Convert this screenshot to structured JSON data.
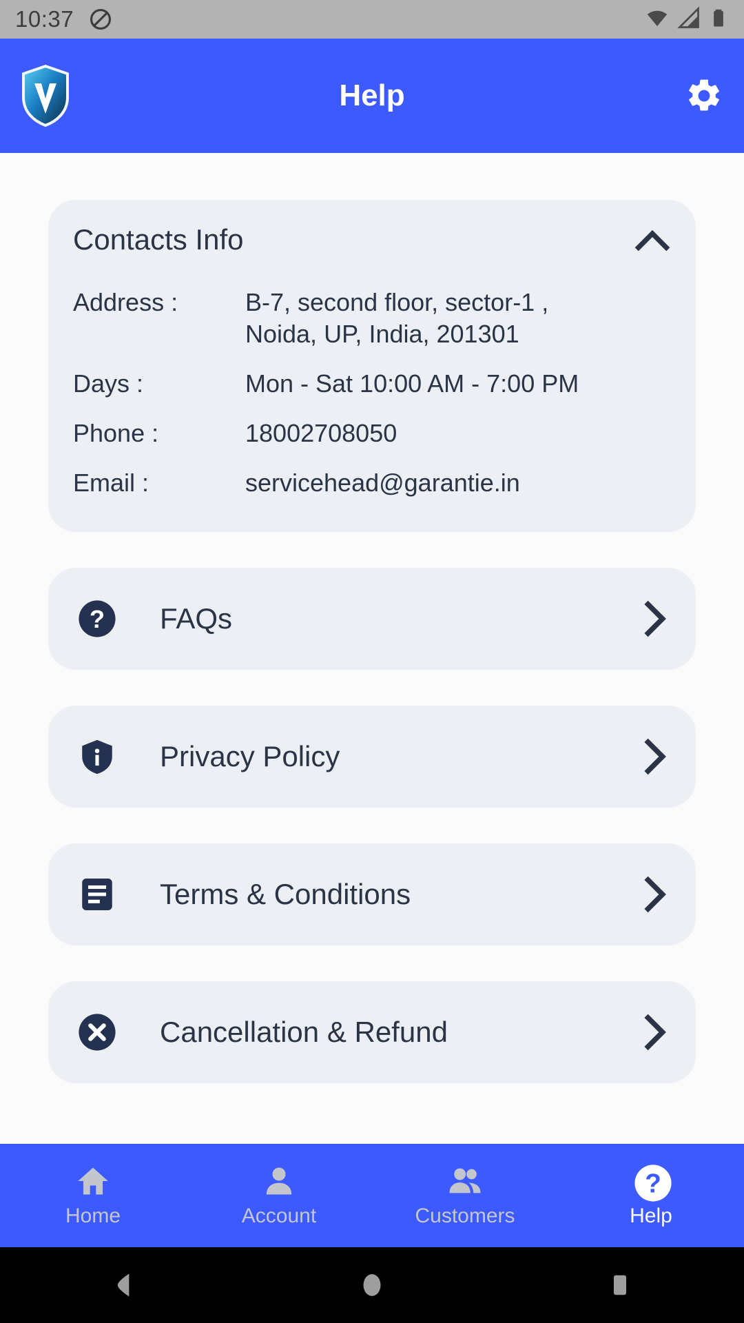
{
  "status_bar": {
    "time": "10:37",
    "icons": [
      "dnd-icon",
      "wifi-icon",
      "cellular-signal-icon",
      "battery-icon"
    ]
  },
  "app_bar": {
    "logo_icon": "shield-v-logo-icon",
    "title": "Help",
    "settings_icon": "gear-icon"
  },
  "contacts_card": {
    "title": "Contacts Info",
    "toggle_icon": "chevron-up-icon",
    "expanded": true,
    "rows": [
      {
        "key": "Address :",
        "value": "B-7, second floor, sector-1 ,\nNoida, UP, India, 201301"
      },
      {
        "key": "Days :",
        "value": "Mon - Sat 10:00 AM - 7:00 PM"
      },
      {
        "key": "Phone :",
        "value": "18002708050"
      },
      {
        "key": "Email :",
        "value": "servicehead@garantie.in"
      }
    ]
  },
  "menu": {
    "items": [
      {
        "label": "FAQs",
        "icon": "question-circle-icon",
        "chevron_icon": "chevron-right-icon"
      },
      {
        "label": "Privacy Policy",
        "icon": "shield-info-icon",
        "chevron_icon": "chevron-right-icon"
      },
      {
        "label": "Terms & Conditions",
        "icon": "document-lines-icon",
        "chevron_icon": "chevron-right-icon"
      },
      {
        "label": "Cancellation & Refund",
        "icon": "close-circle-icon",
        "chevron_icon": "chevron-right-icon"
      }
    ]
  },
  "bottom_nav": {
    "items": [
      {
        "label": "Home",
        "icon": "home-icon",
        "active": false
      },
      {
        "label": "Account",
        "icon": "person-icon",
        "active": false
      },
      {
        "label": "Customers",
        "icon": "people-icon",
        "active": false
      },
      {
        "label": "Help",
        "icon": "help-icon",
        "active": true
      }
    ]
  },
  "android_nav": {
    "back_icon": "back-triangle-icon",
    "home_icon": "home-circle-icon",
    "recents_icon": "recents-square-icon"
  },
  "colors": {
    "brand_blue": "#3d5afe",
    "card_gray": "#eceff3",
    "text_navy": "#2b3446",
    "status_gray": "#b3b3b3",
    "nav_inactive": "#c3c6cc"
  }
}
